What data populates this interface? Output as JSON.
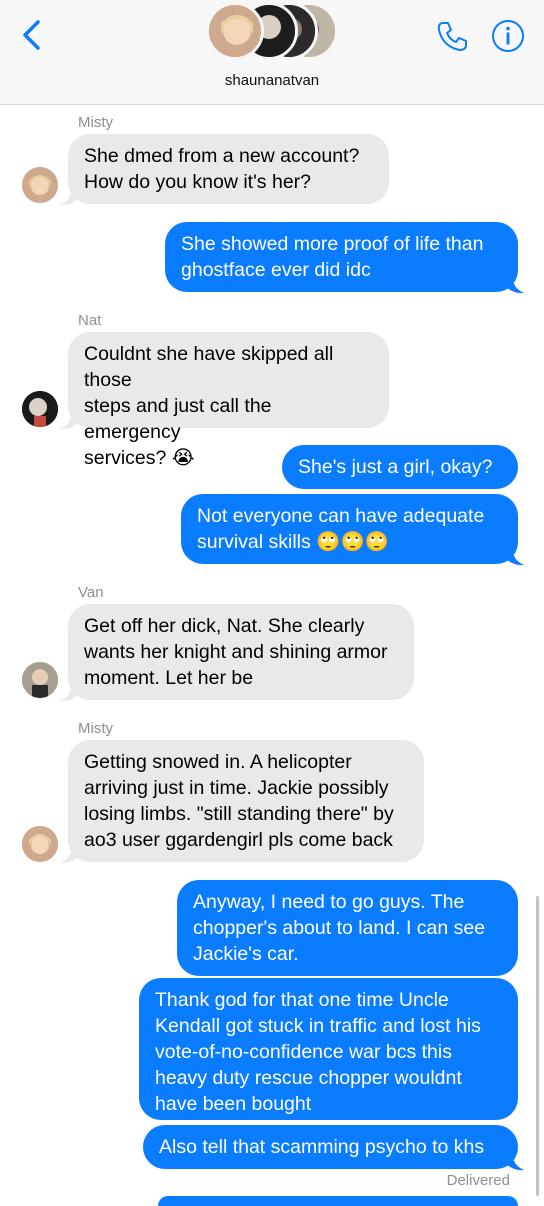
{
  "header": {
    "title": "shaunanatvan",
    "back_icon": "chevron-left-icon",
    "call_icon": "phone-icon",
    "info_icon": "info-icon",
    "accent": "#0a7cff"
  },
  "messages": [
    {
      "sender": "Misty",
      "text": "She dmed from a new account?\nHow do you know it's her?"
    },
    {
      "text": "She showed more proof of life than\nghostface ever did idc"
    },
    {
      "sender": "Nat",
      "text": "Couldnt she have skipped all those\nsteps and just call the emergency\nservices? 😭"
    },
    {
      "text": "She's just a girl, okay?"
    },
    {
      "text": "Not everyone can have adequate\nsurvival skills 🙄🙄🙄"
    },
    {
      "sender": "Van",
      "text": "Get off her dick, Nat. She clearly\nwants her knight and shining armor\nmoment. Let her be"
    },
    {
      "sender": "Misty",
      "text": "Getting snowed in. A helicopter\narriving just in time. Jackie possibly\nlosing limbs. \"still standing there\" by\nao3 user ggardengirl pls come back"
    },
    {
      "text": "Anyway, I need to go guys. The\nchopper's about to land. I can see\nJackie's car."
    },
    {
      "text": "Thank god for that one time Uncle\nKendall got stuck in traffic and lost his\nvote-of-no-confidence war bcs this\nheavy duty rescue chopper wouldnt\nhave been bought"
    },
    {
      "text": "Also tell that scamming psycho to khs"
    }
  ],
  "status": {
    "delivered": "Delivered"
  }
}
